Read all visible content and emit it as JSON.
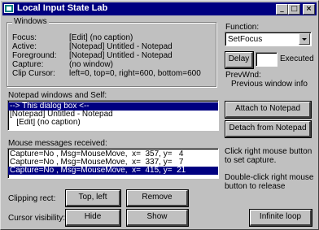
{
  "window": {
    "title": "Local Input State Lab",
    "minimize": "_",
    "maximize": "□",
    "close": "×"
  },
  "windows_group": {
    "title": "Windows",
    "rows": [
      {
        "label": "Focus:",
        "value": "[Edit] (no caption)"
      },
      {
        "label": "Active:",
        "value": "[Notepad] Untitled - Notepad"
      },
      {
        "label": "Foreground:",
        "value": "[Notepad] Untitled - Notepad"
      },
      {
        "label": "Capture:",
        "value": "(no window)"
      },
      {
        "label": "Clip Cursor:",
        "value": "left=0, top=0, right=600, bottom=600"
      }
    ]
  },
  "function_panel": {
    "label": "Function:",
    "selected": "SetFocus",
    "delay_button": "Delay",
    "delay_value": "",
    "executed_label": "Executed",
    "prevwnd_label": "PrevWnd:",
    "prevwnd_value": "Previous window info"
  },
  "windows_list": {
    "label": "Notepad windows and Self:",
    "items": [
      "--> This dialog box <--",
      "[Notepad] Untitled - Notepad",
      "   [Edit] (no caption)"
    ],
    "selected_index": 0
  },
  "notepad_buttons": {
    "attach": "Attach to Notepad",
    "detach": "Detach from Notepad"
  },
  "messages": {
    "label": "Mouse messages received:",
    "rows": [
      "Capture=No , Msg=MouseMove,  x=  357, y=   4",
      "Capture=No , Msg=MouseMove,  x=  337, y=   7",
      "Capture=No , Msg=MouseMove,  x=  415, y=  21"
    ],
    "selected_index": 2
  },
  "hints": {
    "right_click": "Click right mouse button to set capture.",
    "double_click": "Double-click right mouse button to release"
  },
  "clipping": {
    "label": "Clipping rect:",
    "top_left": "Top, left",
    "remove": "Remove"
  },
  "cursor": {
    "label": "Cursor visibility:",
    "hide": "Hide",
    "show": "Show"
  },
  "infinite_loop": "Infinite loop"
}
